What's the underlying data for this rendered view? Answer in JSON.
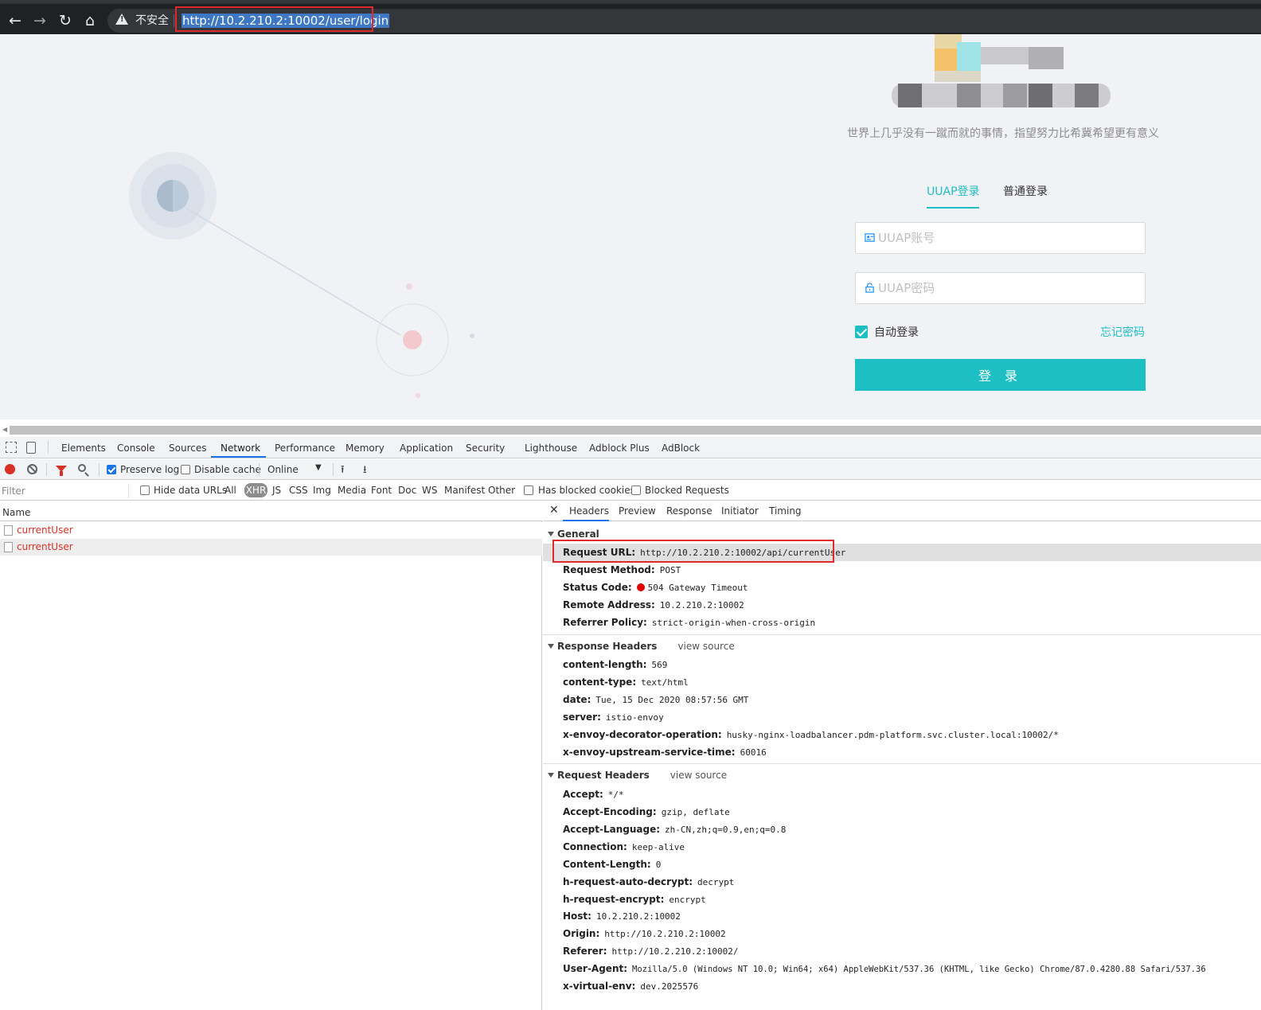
{
  "browser": {
    "not_secure": "不安全",
    "url": "http://10.2.210.2:10002/user/login",
    "icons": [
      "back-icon",
      "forward-icon",
      "reload-icon",
      "home-icon",
      "warning-icon"
    ]
  },
  "login": {
    "slogan": "世界上几乎没有一蹴而就的事情，指望努力比希冀希望更有意义",
    "tab_uuap": "UUAP登录",
    "tab_normal": "普通登录",
    "account_placeholder": "UUAP账号",
    "password_placeholder": "UUAP密码",
    "auto_login": "自动登录",
    "forgot_password": "忘记密码",
    "login_button": "登 录",
    "accent_color": "#1dbfc5"
  },
  "devtools": {
    "tabs": [
      "Elements",
      "Console",
      "Sources",
      "Network",
      "Performance",
      "Memory",
      "Application",
      "Security",
      "Lighthouse",
      "Adblock Plus",
      "AdBlock"
    ],
    "toolbar": {
      "preserve_log": "Preserve log",
      "disable_cache": "Disable cache",
      "throttle": "Online"
    },
    "filter": {
      "placeholder": "Filter",
      "hide_data_urls": "Hide data URLs",
      "types": [
        "All",
        "XHR",
        "JS",
        "CSS",
        "Img",
        "Media",
        "Font",
        "Doc",
        "WS",
        "Manifest",
        "Other"
      ],
      "has_blocked_cookies": "Has blocked cookies",
      "blocked_requests": "Blocked Requests"
    },
    "list": {
      "header": "Name",
      "rows": [
        "currentUser",
        "currentUser"
      ]
    },
    "detail_tabs": [
      "Headers",
      "Preview",
      "Response",
      "Initiator",
      "Timing"
    ],
    "general": {
      "title": "General",
      "items": [
        {
          "k": "Request URL:",
          "v": "http://10.2.210.2:10002/api/currentUser"
        },
        {
          "k": "Request Method:",
          "v": "POST"
        },
        {
          "k": "Status Code:",
          "v": "504 Gateway Timeout"
        },
        {
          "k": "Remote Address:",
          "v": "10.2.210.2:10002"
        },
        {
          "k": "Referrer Policy:",
          "v": "strict-origin-when-cross-origin"
        }
      ]
    },
    "response_headers": {
      "title": "Response Headers",
      "view_source": "view source",
      "items": [
        {
          "k": "content-length:",
          "v": "569"
        },
        {
          "k": "content-type:",
          "v": "text/html"
        },
        {
          "k": "date:",
          "v": "Tue, 15 Dec 2020 08:57:56 GMT"
        },
        {
          "k": "server:",
          "v": "istio-envoy"
        },
        {
          "k": "x-envoy-decorator-operation:",
          "v": "husky-nginx-loadbalancer.pdm-platform.svc.cluster.local:10002/*"
        },
        {
          "k": "x-envoy-upstream-service-time:",
          "v": "60016"
        }
      ]
    },
    "request_headers": {
      "title": "Request Headers",
      "view_source": "view source",
      "items": [
        {
          "k": "Accept:",
          "v": "*/*"
        },
        {
          "k": "Accept-Encoding:",
          "v": "gzip, deflate"
        },
        {
          "k": "Accept-Language:",
          "v": "zh-CN,zh;q=0.9,en;q=0.8"
        },
        {
          "k": "Connection:",
          "v": "keep-alive"
        },
        {
          "k": "Content-Length:",
          "v": "0"
        },
        {
          "k": "h-request-auto-decrypt:",
          "v": "decrypt"
        },
        {
          "k": "h-request-encrypt:",
          "v": "encrypt"
        },
        {
          "k": "Host:",
          "v": "10.2.210.2:10002"
        },
        {
          "k": "Origin:",
          "v": "http://10.2.210.2:10002"
        },
        {
          "k": "Referer:",
          "v": "http://10.2.210.2:10002/"
        },
        {
          "k": "User-Agent:",
          "v": "Mozilla/5.0 (Windows NT 10.0; Win64; x64) AppleWebKit/537.36 (KHTML, like Gecko) Chrome/87.0.4280.88 Safari/537.36"
        },
        {
          "k": "x-virtual-env:",
          "v": "dev.2025576"
        }
      ]
    },
    "status_color": "#e00000"
  }
}
